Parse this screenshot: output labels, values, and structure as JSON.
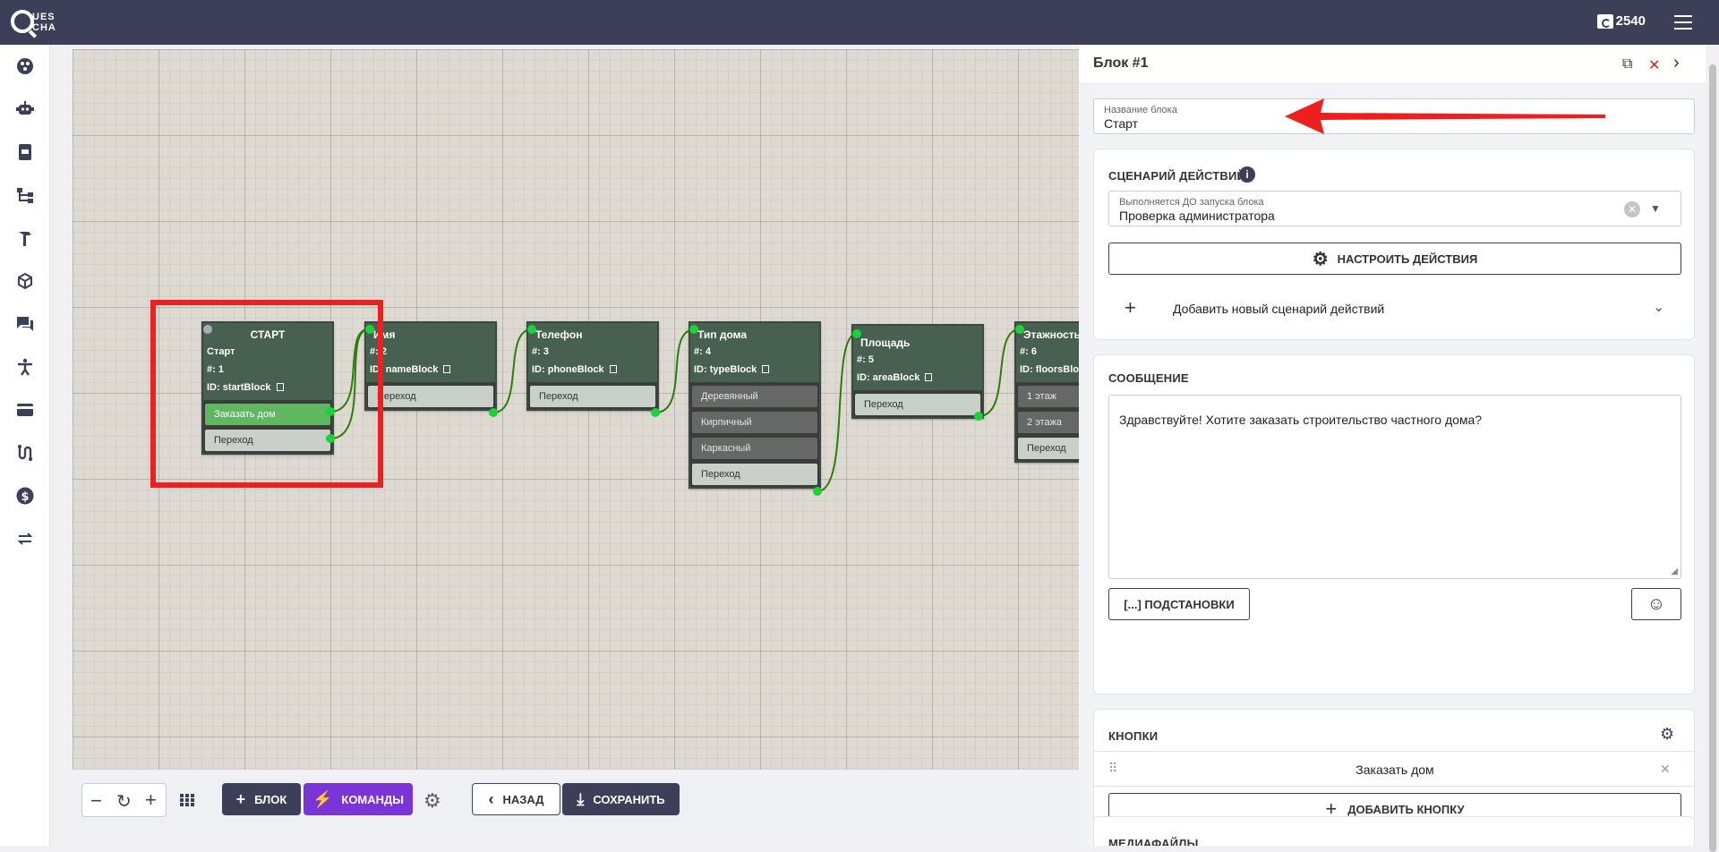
{
  "header": {
    "logo_line1": "UES",
    "logo_line2": "CHA",
    "balance": "2540"
  },
  "rail": {
    "icons": [
      "dashboard-icon",
      "robot-icon",
      "device-icon",
      "tree-icon",
      "hammer-icon",
      "cube-icon",
      "chat-icon",
      "accessibility-icon",
      "card-icon",
      "route-icon",
      "dollar-icon",
      "swap-icon"
    ]
  },
  "canvas": {
    "nodes": [
      {
        "title": "СТАРТ",
        "name": "Старт",
        "num": "#: 1",
        "id": "ID: startBlock",
        "options": [
          "Заказать дом",
          "Переход"
        ]
      },
      {
        "title": "Имя",
        "num": "#: 2",
        "id": "ID: nameBlock",
        "options": [
          "Переход"
        ]
      },
      {
        "title": "Телефон",
        "num": "#: 3",
        "id": "ID: phoneBlock",
        "options": [
          "Переход"
        ]
      },
      {
        "title": "Тип дома",
        "num": "#: 4",
        "id": "ID: typeBlock",
        "options": [
          "Деревянный",
          "Кирпичный",
          "Каркасный",
          "Переход"
        ]
      },
      {
        "title": "Площадь",
        "num": "#: 5",
        "id": "ID: areaBlock",
        "options": [
          "Переход"
        ]
      },
      {
        "title": "Этажность",
        "num": "#: 6",
        "id": "ID: floorsBlock",
        "options": [
          "1 этаж",
          "2 этажа",
          "Переход"
        ]
      }
    ]
  },
  "toolbar": {
    "block_label": "БЛОК",
    "commands_label": "КОМАНДЫ",
    "back_label": "НАЗАД",
    "save_label": "СОХРАНИТЬ"
  },
  "panel": {
    "title": "Блок #1",
    "block_name_label": "Название блока",
    "block_name_value": "Старт",
    "scenario_title": "СЦЕНАРИЙ ДЕЙСТВИЙ",
    "scenario_select_label": "Выполняется ДО запуска блока",
    "scenario_select_value": "Проверка администратора",
    "configure_actions": "НАСТРОИТЬ ДЕЙСТВИЯ",
    "add_scenario": "Добавить новый сценарий действий",
    "message_title": "СООБЩЕНИЕ",
    "message_text": "Здравствуйте! Хотите заказать строительство частного дома?",
    "substitutions": "[...] ПОДСТАНОВКИ",
    "buttons_title": "КНОПКИ",
    "button_item": "Заказать дом",
    "add_button": "ДОБАВИТЬ КНОПКУ",
    "media_title": "МЕДИАФАЙЛЫ"
  },
  "colors": {
    "topbar": "#3c3f58",
    "node_bg": "#4a5e4e",
    "connector": "#1bd23a",
    "commands": "#7b35d6",
    "highlight": "#ef1f1f"
  }
}
